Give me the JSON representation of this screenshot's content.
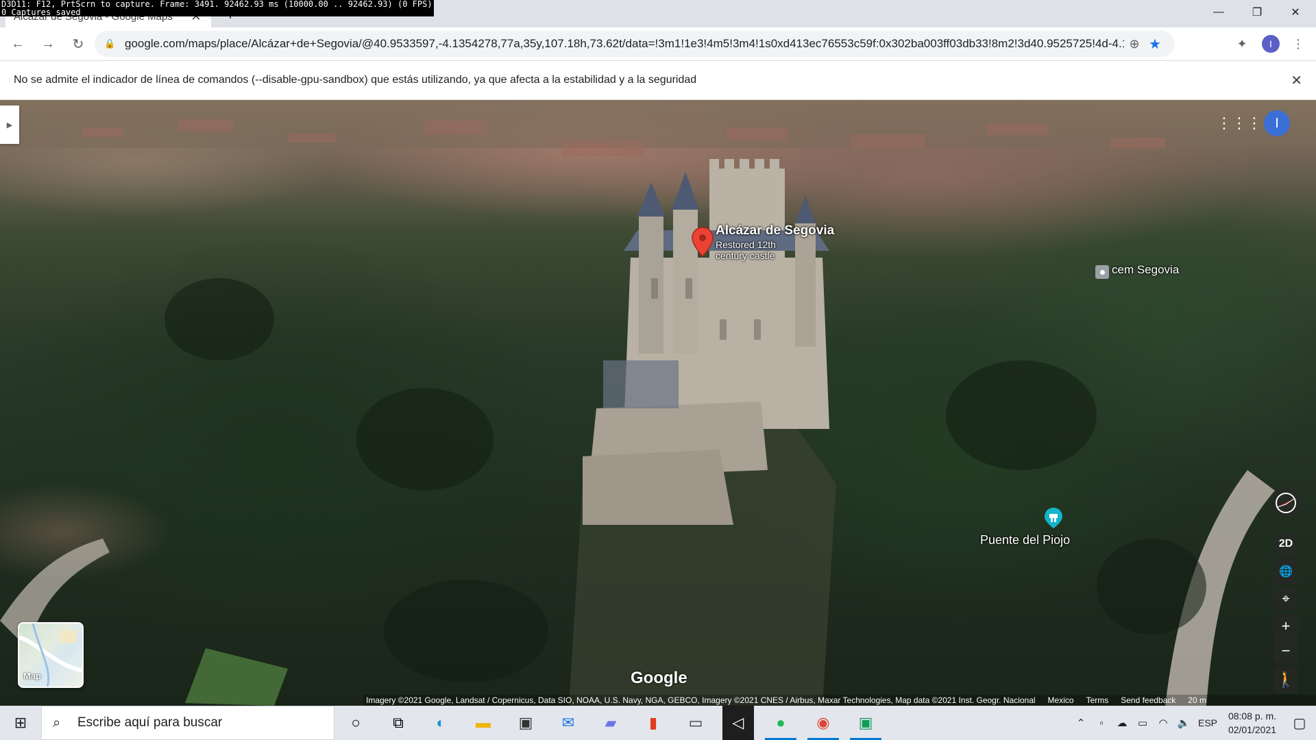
{
  "debug": {
    "line1": "D3D11: F12, PrtScrn to capture. Frame: 3491. 92462.93 ms (10000.00 .. 92462.93) (0 FPS)",
    "line2": "0 Captures saved"
  },
  "browser": {
    "tab_title": "Alcázar de Segovia - Google Maps",
    "new_tab_icon": "plus-icon",
    "url": "google.com/maps/place/Alcázar+de+Segovia/@40.9533597,-4.1354278,77a,35y,107.18h,73.62t/data=!3m1!1e3!4m5!3m4!1s0xd413ec76553c59f:0x302ba003ff03db33!8m2!3d40.9525725!4d-4.132...",
    "profile_initial": "I",
    "infobar_message": "No se admite el indicador de línea de comandos (--disable-gpu-sandbox) que estás utilizando, ya que afecta a la estabilidad y a la seguridad"
  },
  "map": {
    "places": [
      {
        "name": "Alcázar de Segovia",
        "description": "Restored 12th century castle"
      },
      {
        "name": "cem Segovia"
      },
      {
        "name": "Puente del Piojo"
      }
    ],
    "controls": {
      "mode_2d": "2D",
      "minimap_label": "Map",
      "profile_initial": "I"
    },
    "logo": "Google",
    "attribution": {
      "imagery": "Imagery ©2021 Google, Landsat / Copernicus, Data SIO, NOAA, U.S. Navy, NGA, GEBCO, Imagery ©2021 CNES / Airbus, Maxar Technologies, Map data ©2021 Inst. Geogr. Nacional",
      "region": "Mexico",
      "terms": "Terms",
      "feedback": "Send feedback",
      "scale": "20 m"
    },
    "colors": {
      "pin_red": "#ea4335",
      "teal_marker": "#12b5cb"
    }
  },
  "taskbar": {
    "search_placeholder": "Escribe aquí para buscar",
    "apps": [
      "cortana-icon",
      "task-view-icon",
      "edge-icon",
      "file-explorer-icon",
      "store-icon",
      "mail-icon",
      "app-icon",
      "office-icon",
      "terminal-icon",
      "visual-studio-icon",
      "spotify-icon",
      "chrome-icon",
      "app-green-icon"
    ],
    "language": "ESP",
    "time": "08:08 p. m.",
    "date": "02/01/2021"
  }
}
